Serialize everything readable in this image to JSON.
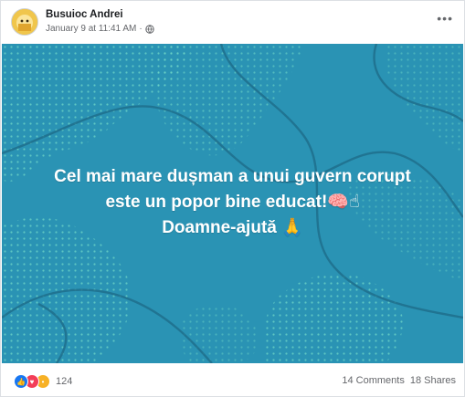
{
  "post": {
    "author": "Busuioc Andrei",
    "timestamp": "January 9 at 11:41 AM",
    "separator": "·",
    "privacy_icon": "globe-icon",
    "more_label": "•••",
    "text_lines": [
      "Cel mai mare dușman a unui guvern corupt",
      "este un popor bine educat!🧠☝",
      "Doamne-ajută 🙏"
    ],
    "background_color": "#2a93b4",
    "dot_color": "#6fd6c6"
  },
  "footer": {
    "reaction_icons": [
      "like-icon",
      "love-icon",
      "sad-icon"
    ],
    "reaction_count": "124",
    "comments": "14 Comments",
    "shares": "18 Shares"
  }
}
